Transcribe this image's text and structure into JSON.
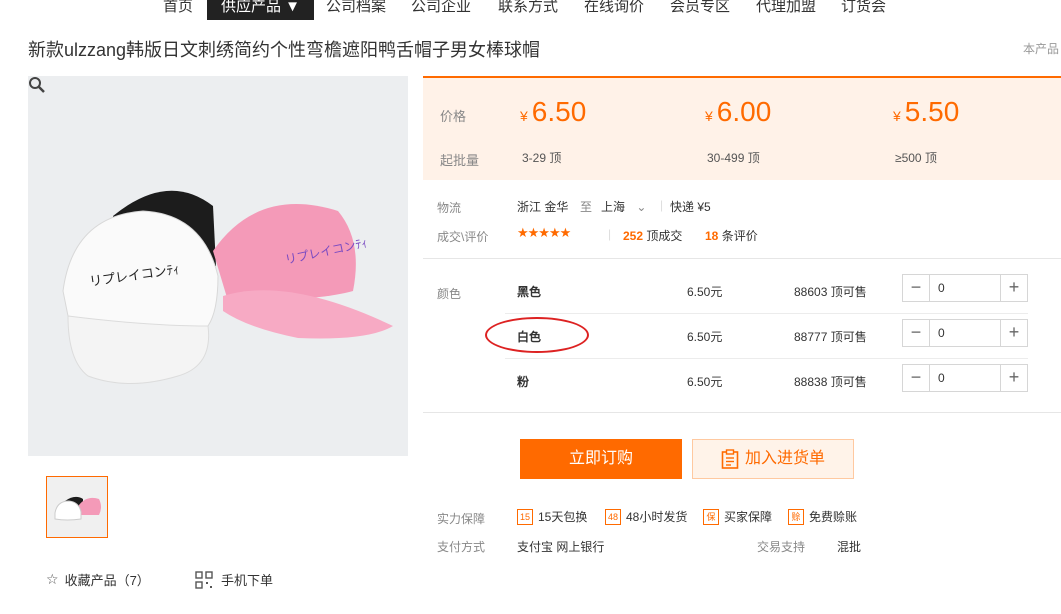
{
  "nav": {
    "items": [
      "首页",
      "供应产品 ▼",
      "公司档案",
      "公司企业",
      "联系方式",
      "在线询价",
      "会员专区",
      "代理加盟",
      "订货会"
    ],
    "active_index": 1
  },
  "product": {
    "title": "新款ulzzang韩版日文刺绣简约个性弯檐遮阳鸭舌帽子男女棒球帽",
    "corner_note": "本产品"
  },
  "price_panel": {
    "price_label": "价格",
    "moq_label": "起批量",
    "currency": "¥",
    "tiers": [
      {
        "price": "6.50",
        "moq": "3-29",
        "unit": "顶"
      },
      {
        "price": "6.00",
        "moq": "30-499",
        "unit": "顶"
      },
      {
        "price": "5.50",
        "moq": "≥500",
        "unit": "顶"
      }
    ]
  },
  "logistics": {
    "label": "物流",
    "from": "浙江 金华",
    "to_word": "至",
    "to": "上海",
    "shipping": "快递 ¥5"
  },
  "reviews": {
    "label": "成交\\评价",
    "rating": 4.5,
    "stars": "★★★★★",
    "deals_count": "252",
    "deals_suffix": "顶成交",
    "review_count": "18",
    "review_suffix": "条评价"
  },
  "colors": {
    "label": "颜色",
    "skus": [
      {
        "name": "黑色",
        "price": "6.50元",
        "stock": "88603 顶可售",
        "qty": "0"
      },
      {
        "name": "白色",
        "price": "6.50元",
        "stock": "88777 顶可售",
        "qty": "0"
      },
      {
        "name": "粉",
        "price": "6.50元",
        "stock": "88838 顶可售",
        "qty": "0"
      }
    ]
  },
  "actions": {
    "buy_label": "立即订购",
    "cart_label": "加入进货单"
  },
  "guarantees": {
    "label": "实力保障",
    "items": [
      {
        "icon": "15",
        "text": "15天包换"
      },
      {
        "icon": "48",
        "text": "48小时发货"
      },
      {
        "icon": "保",
        "text": "买家保障"
      },
      {
        "icon": "赊",
        "text": "免费赊账"
      }
    ]
  },
  "payment": {
    "label": "支付方式",
    "methods": "支付宝   网上银行",
    "trade_label": "交易支持",
    "trade_value": "混批"
  },
  "footer": {
    "favorite": "收藏产品（7）",
    "mobile_order": "手机下单"
  },
  "colors_theme": {
    "accent": "#ff6a00",
    "panel_bg": "#fff2e8",
    "annotation": "#dd2222"
  }
}
